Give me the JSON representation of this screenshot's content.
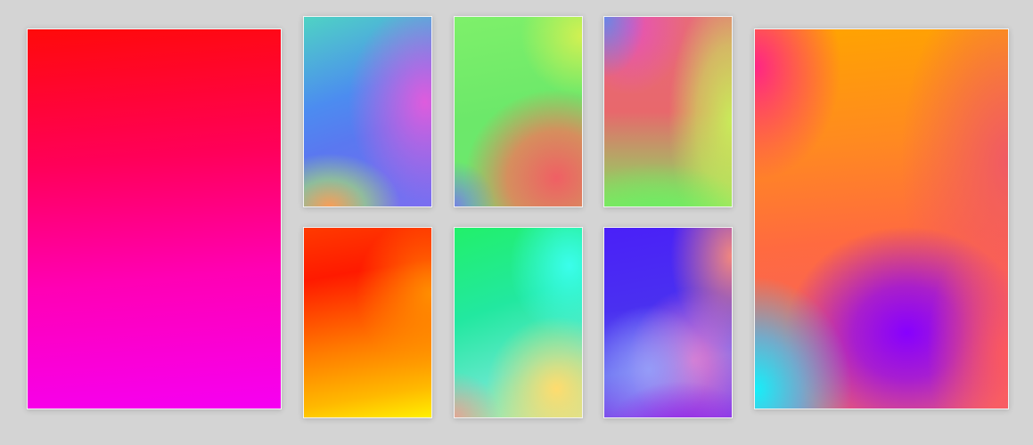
{
  "gallery": {
    "cards": [
      {
        "id": "large-left",
        "palette": [
          "#ff0a0a",
          "#ff005a",
          "#ff00b4",
          "#f600f2"
        ]
      },
      {
        "id": "top-1",
        "palette": [
          "#4fd3c4",
          "#4c8cf0",
          "#e65adc",
          "#ffa050"
        ]
      },
      {
        "id": "top-2",
        "palette": [
          "#7ef06a",
          "#d7f050",
          "#f05f64",
          "#7878f0"
        ]
      },
      {
        "id": "top-3",
        "palette": [
          "#e86a7a",
          "#e650be",
          "#c8eb5a",
          "#6eeb64"
        ]
      },
      {
        "id": "bottom-1",
        "palette": [
          "#ff1a00",
          "#ff7a00",
          "#ffb800",
          "#fff000"
        ]
      },
      {
        "id": "bottom-2",
        "palette": [
          "#22f06a",
          "#3cfff0",
          "#ffdc6e",
          "#fa968c"
        ]
      },
      {
        "id": "bottom-3",
        "palette": [
          "#4a20f8",
          "#fa8c78",
          "#f078c8",
          "#96a0fa"
        ]
      },
      {
        "id": "large-right",
        "palette": [
          "#ffa400",
          "#ff1e8c",
          "#8700ff",
          "#14f0fa"
        ]
      }
    ]
  }
}
